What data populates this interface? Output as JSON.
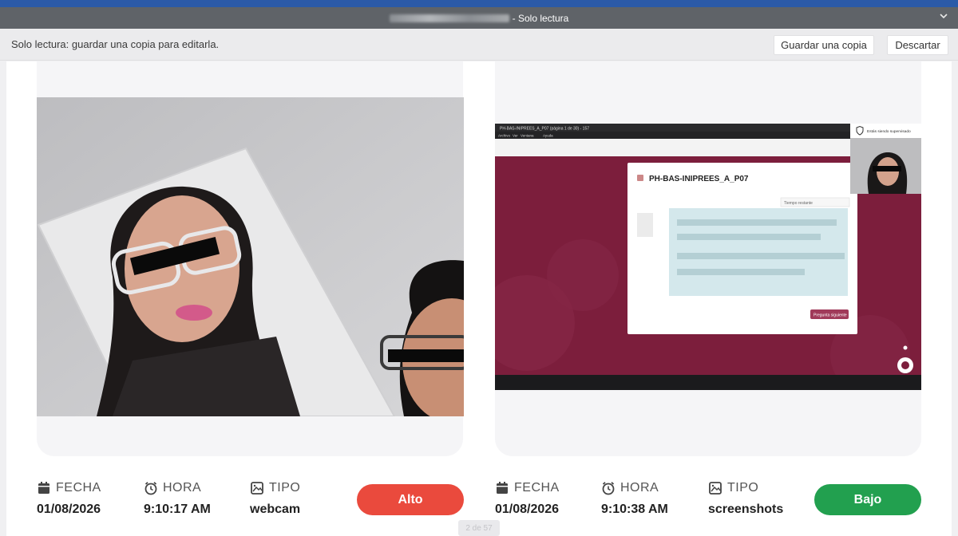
{
  "window": {
    "title_suffix": "- Solo lectura"
  },
  "infobar": {
    "message": "Solo lectura: guardar una copia para editarla.",
    "save_copy_label": "Guardar una copia",
    "discard_label": "Descartar"
  },
  "screenshot_ui": {
    "window_title": "PH-BAS-INIPREES_A_P07 (página 1 de 30) - 157",
    "menu": [
      "Archivo",
      "Ver",
      "Ventana",
      "Ayuda"
    ],
    "exam_title": "PH-BAS-INIPREES_A_P07",
    "time_remaining": "Tiempo restante",
    "next_question": "Pregunta siguiente",
    "supervised_label": "Estás siendo supervisado"
  },
  "records": [
    {
      "fecha_label": "FECHA",
      "fecha": "01/08/2026",
      "hora_label": "HORA",
      "hora": "9:10:17 AM",
      "tipo_label": "TIPO",
      "tipo": "webcam",
      "risk": "Alto",
      "risk_color": "#ea4a3d"
    },
    {
      "fecha_label": "FECHA",
      "fecha": "01/08/2026",
      "hora_label": "HORA",
      "hora": "9:10:38 AM",
      "tipo_label": "TIPO",
      "tipo": "screenshots",
      "risk": "Bajo",
      "risk_color": "#22a04f"
    }
  ],
  "pager": {
    "text": "2 de 57"
  },
  "icons": {
    "calendar": "calendar-icon",
    "clock": "alarm-clock-icon",
    "type": "image-type-icon",
    "chevron": "chevron-down-icon"
  }
}
